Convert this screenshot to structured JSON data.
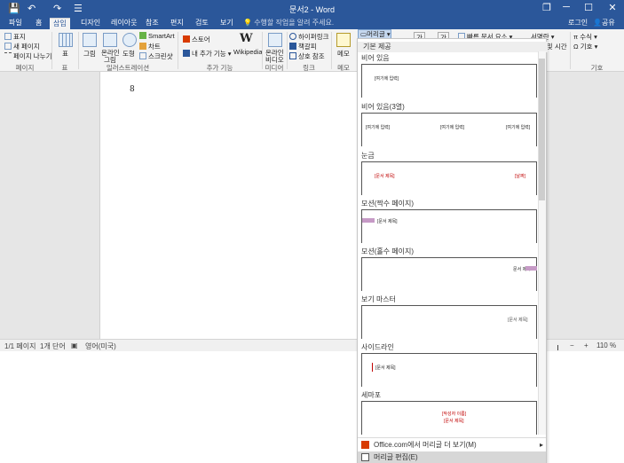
{
  "window": {
    "title": "문서2 - Word",
    "controls": {
      "restore": "❐",
      "minimize": "─",
      "maximize": "☐",
      "close": "✕"
    }
  },
  "qat": {
    "save": "💾",
    "undo": "↶",
    "redo": "↷",
    "customize": "☰"
  },
  "tabs": [
    "파일",
    "홈",
    "삽입",
    "디자인",
    "레이아웃",
    "참조",
    "편지",
    "검토",
    "보기"
  ],
  "active_tab": "삽입",
  "tell_me": "수행할 작업을 알려 주세요.",
  "account": {
    "login": "로그인",
    "share": "공유"
  },
  "ribbon": {
    "pages": {
      "items": [
        "표지",
        "새 페이지",
        "페이지 나누기"
      ],
      "label": "페이지"
    },
    "table": {
      "button": "표",
      "label": "표"
    },
    "illustrations": {
      "picture": "그림",
      "online_picture_1": "온라인",
      "online_picture_2": "그림",
      "shapes": "도형",
      "smartart": "SmartArt",
      "chart": "차트",
      "screenshot": "스크린샷",
      "label": "일러스트레이션"
    },
    "addins": {
      "store": "스토어",
      "my_addins": "내 추가 기능",
      "wikipedia": "Wikipedia",
      "label": "추가 기능"
    },
    "media": {
      "online_video_1": "온라인",
      "online_video_2": "비디오",
      "label": "미디어"
    },
    "links": {
      "hyperlink": "하이퍼링크",
      "bookmark": "책갈피",
      "cross_ref": "상호 참조",
      "label": "링크"
    },
    "comments": {
      "memo": "메모",
      "label": "메모"
    },
    "header_footer": {
      "header_button": "머리글"
    },
    "text": {
      "quick_parts": "빠른 문서 요소",
      "signature": "서명란",
      "datetime": "날짜 및 시간"
    },
    "symbols": {
      "equation": "수식",
      "symbol": "기호",
      "label": "기호"
    }
  },
  "document": {
    "mark": "8"
  },
  "statusbar": {
    "page": "1/1 페이지",
    "words": "1개 단어",
    "language": "영어(미국)",
    "zoom": "110 %"
  },
  "dropdown": {
    "section": "기본 제공",
    "presets": [
      {
        "name": "비어 있음",
        "texts": [
          "[여기에 입력]"
        ]
      },
      {
        "name": "비어 있음(3열)",
        "texts": [
          "[여기에 입력]",
          "[여기에 입력]",
          "[여기에 입력]"
        ]
      },
      {
        "name": "눈금",
        "texts": [
          "[문서 제목]",
          "[날짜]"
        ]
      },
      {
        "name": "모션(짝수 페이지)",
        "texts": [
          "[문서 제목]"
        ]
      },
      {
        "name": "모션(홀수 페이지)",
        "texts": [
          "문서 제목"
        ]
      },
      {
        "name": "보기 마스터",
        "texts": [
          "[문서 제목]"
        ]
      },
      {
        "name": "사이드라인",
        "texts": [
          "[문서 제목]"
        ]
      },
      {
        "name": "세마포",
        "texts": [
          "[작성자 이름]",
          "[문서 제목]"
        ]
      }
    ],
    "more_online": "Office.com에서 머리글 더 보기(M)",
    "edit_header": "머리글 편집(E)"
  },
  "colors": {
    "brand": "#2b579a",
    "accent_red": "#c00000",
    "accent_purple": "#c69ac6"
  }
}
